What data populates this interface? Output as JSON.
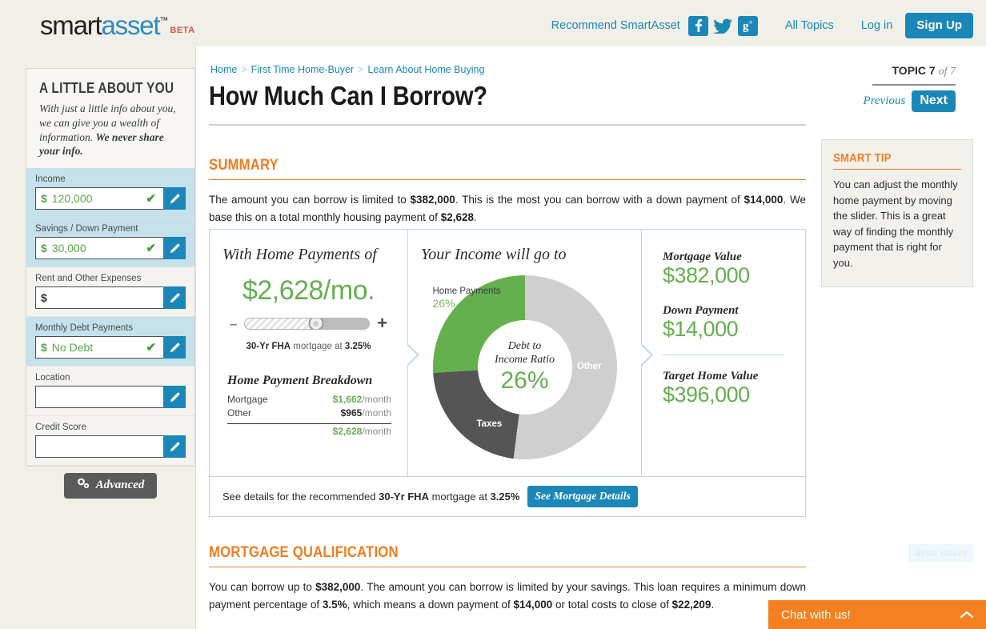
{
  "header": {
    "logo": {
      "part1": "smart",
      "part2": "asset",
      "tm": "™",
      "beta": "BETA"
    },
    "recommend": "Recommend SmartAsset",
    "social": [
      "facebook-icon",
      "twitter-icon",
      "googleplus-icon"
    ],
    "all_topics": "All Topics",
    "login": "Log in",
    "signup": "Sign Up"
  },
  "sidebar": {
    "title": "A LITTLE ABOUT YOU",
    "desc_plain": "With just a little info about you, we can give you a wealth of information. ",
    "desc_bold": "We never share your info.",
    "fields": [
      {
        "label": "Income",
        "currency": "$",
        "value": "120,000",
        "filled": true,
        "has_currency": true
      },
      {
        "label": "Savings / Down Payment",
        "currency": "$",
        "value": "30,000",
        "filled": true,
        "has_currency": true
      },
      {
        "label": "Rent and Other Expenses",
        "currency": "$",
        "value": "",
        "filled": false,
        "has_currency": true
      },
      {
        "label": "Monthly Debt Payments",
        "currency": "$",
        "value": "No Debt",
        "filled": true,
        "has_currency": true
      },
      {
        "label": "Location",
        "currency": "",
        "value": "",
        "filled": false,
        "has_currency": false
      },
      {
        "label": "Credit Score",
        "currency": "",
        "value": "",
        "filled": false,
        "has_currency": false
      }
    ],
    "advanced": "Advanced"
  },
  "breadcrumb": {
    "items": [
      "Home",
      "First Time Home-Buyer",
      "Learn About Home Buying"
    ],
    "sep": ">"
  },
  "page_title": "How Much Can I Borrow?",
  "topic": {
    "label": "TOPIC",
    "current": "7",
    "of": "of 7",
    "previous": "Previous",
    "next": "Next"
  },
  "summary": {
    "heading": "SUMMARY",
    "p1a": "The amount you can borrow is limited to ",
    "p1b": "$382,000",
    "p1c": ". This is the most you can borrow with a down payment of ",
    "p1d": "$14,000",
    "p1e": ". We base this on a total monthly housing payment of ",
    "p1f": "$2,628",
    "p1g": "."
  },
  "calculator": {
    "col1_title": "With Home Payments of",
    "monthly_payment": "$2,628/mo.",
    "slider": {
      "minus": "–",
      "plus": "+",
      "position_pct": 57
    },
    "rate_pre": "",
    "rate_term": "30-Yr FHA",
    "rate_mid": " mortgage at ",
    "rate_value": "3.25%",
    "breakdown_title": "Home Payment Breakdown",
    "breakdown_rows": [
      {
        "label": "Mortgage",
        "amount": "$1,662",
        "unit": "/month",
        "color": "green"
      },
      {
        "label": "Other",
        "amount": "$965",
        "unit": "/month",
        "color": "dark"
      }
    ],
    "breakdown_total": {
      "amount": "$2,628",
      "unit": "/month"
    },
    "col2_title": "Your Income will go to",
    "donut_center_l1": "Debt to",
    "donut_center_l2": "Income Ratio",
    "donut_center_pct": "26%",
    "label_home_payments": "Home Payments",
    "label_home_payments_pct": "26%",
    "label_other": "Other",
    "label_taxes": "Taxes",
    "col3_items": [
      {
        "label": "Mortgage Value",
        "value": "$382,000"
      },
      {
        "label": "Down Payment",
        "value": "$14,000"
      },
      {
        "label": "Target Home Value",
        "value": "$396,000"
      }
    ],
    "footer_pre": "See details for the recommended ",
    "footer_term": "30-Yr FHA",
    "footer_mid": " mortgage at ",
    "footer_rate": "3.25%",
    "footer_button": "See Mortgage Details",
    "reset": "Reset values"
  },
  "smart_tip": {
    "heading": "SMART TIP",
    "body": "You can adjust the monthly home payment by moving the slider. This is a great way of finding the monthly payment that is right for you."
  },
  "qualification": {
    "heading": "MORTGAGE QUALIFICATION",
    "p1a": "You can borrow up to ",
    "p1b": "$382,000",
    "p1c": ". The amount you can borrow is limited by your savings. This loan requires a minimum down payment percentage of ",
    "p1d": "3.5%",
    "p1e": ", which means a down payment of ",
    "p1f": "$14,000",
    "p1g": " or total costs to close of ",
    "p1h": "$22,209",
    "p1i": "."
  },
  "chat": {
    "label": "Chat with us!",
    "icon": "chevron-up-icon"
  },
  "colors": {
    "brand_blue": "#1b87b8",
    "accent_orange": "#f07d22",
    "green": "#64af4e",
    "chat_orange": "#f5801f"
  },
  "chart_data": {
    "type": "pie",
    "title": "Your Income will go to",
    "center_label": "Debt to Income Ratio",
    "center_value": "26%",
    "categories": [
      "Home Payments",
      "Taxes",
      "Other"
    ],
    "values": [
      26,
      22,
      52
    ],
    "colors": [
      "#64af4e",
      "#555555",
      "#cfcfcf"
    ],
    "legend": "inline-labels",
    "unit": "percent"
  }
}
